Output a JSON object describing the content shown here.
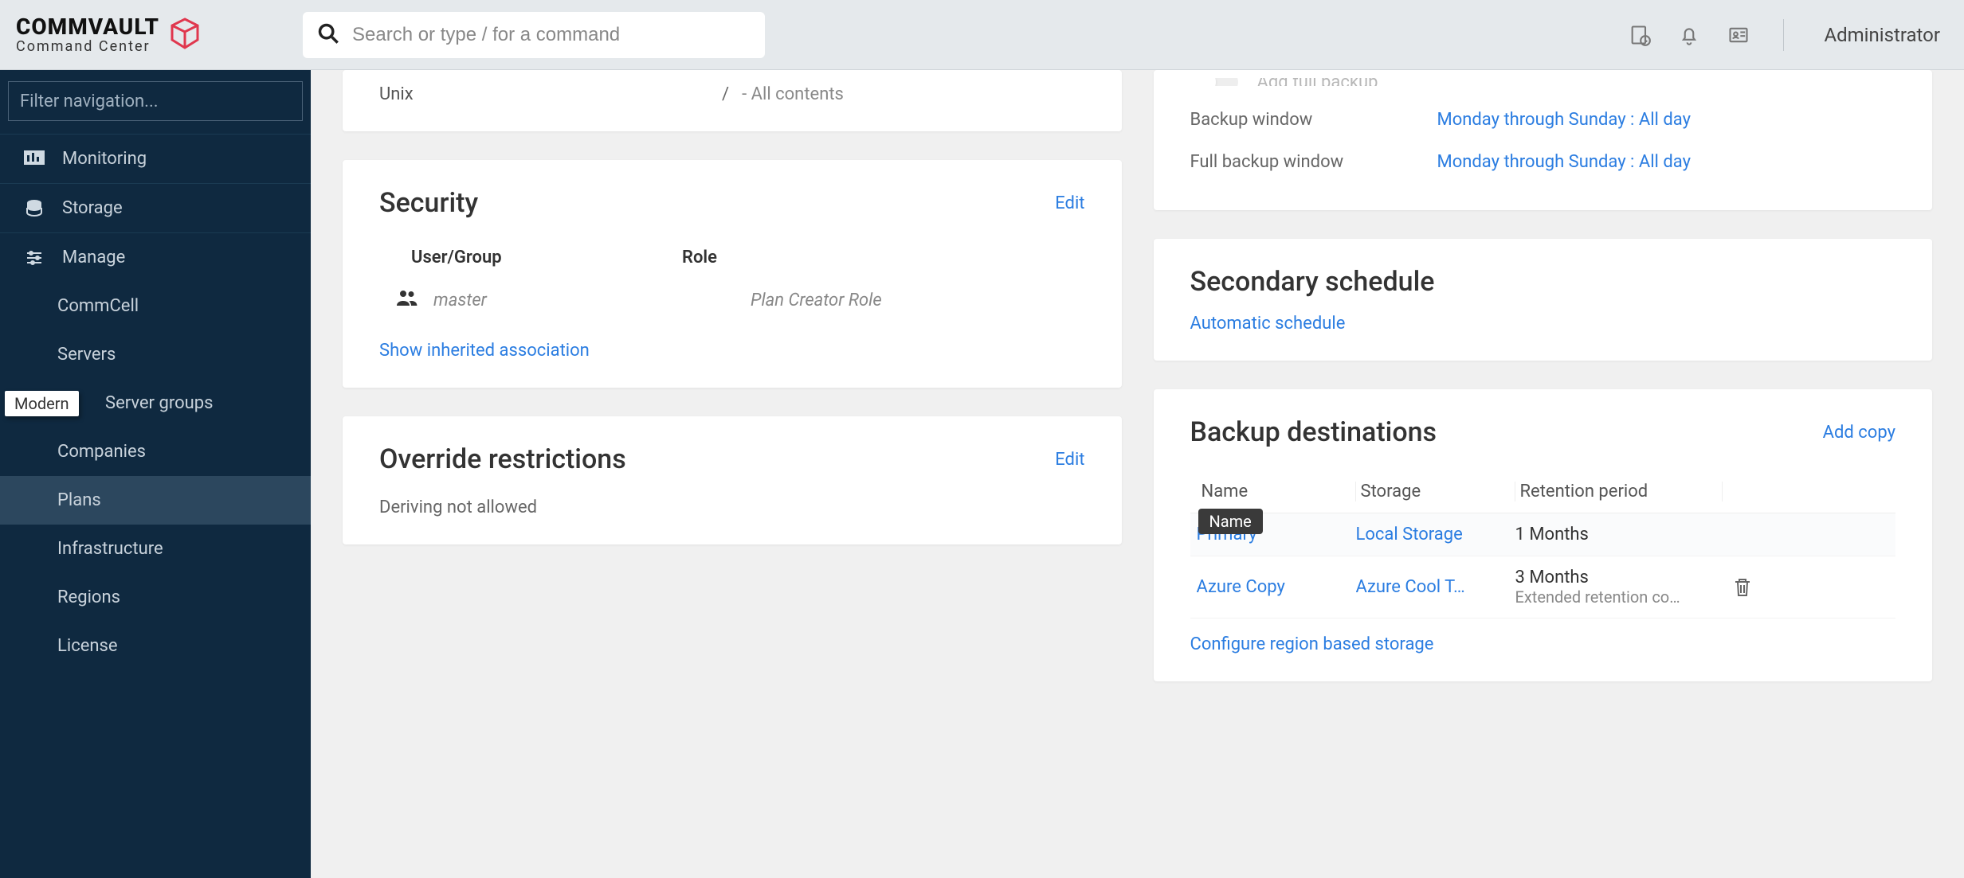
{
  "header": {
    "brand_line1": "COMMVAULT",
    "brand_line2": "Command Center",
    "search_placeholder": "Search or type / for a command",
    "user": "Administrator"
  },
  "sidebar": {
    "filter_placeholder": "Filter navigation...",
    "items": [
      {
        "label": "Monitoring"
      },
      {
        "label": "Storage"
      },
      {
        "label": "Manage"
      }
    ],
    "manage_children": [
      {
        "label": "CommCell"
      },
      {
        "label": "Servers"
      },
      {
        "label": "Server groups",
        "badge": "Modern"
      },
      {
        "label": "Companies"
      },
      {
        "label": "Plans",
        "active": true
      },
      {
        "label": "Infrastructure"
      },
      {
        "label": "Regions"
      },
      {
        "label": "License"
      }
    ]
  },
  "unix_card": {
    "label": "Unix",
    "path": "/",
    "desc": "-  All contents"
  },
  "security": {
    "title": "Security",
    "edit": "Edit",
    "col_user": "User/Group",
    "col_role": "Role",
    "rows": [
      {
        "user": "master",
        "role": "Plan Creator Role"
      }
    ],
    "show_inherited": "Show inherited association"
  },
  "override": {
    "title": "Override restrictions",
    "edit": "Edit",
    "text": "Deriving not allowed"
  },
  "schedule_top": {
    "toggle_label": "Add full backup",
    "rows": [
      {
        "k": "Backup window",
        "v": "Monday through Sunday : All day"
      },
      {
        "k": "Full backup window",
        "v": "Monday through Sunday : All day"
      }
    ]
  },
  "secondary": {
    "title": "Secondary schedule",
    "link": "Automatic schedule"
  },
  "destinations": {
    "title": "Backup destinations",
    "add": "Add copy",
    "col_name": "Name",
    "col_storage": "Storage",
    "col_ret": "Retention period",
    "tooltip": "Name",
    "rows": [
      {
        "name": "Primary",
        "storage": "Local Storage",
        "ret": "1 Months",
        "sub": "",
        "trash": false
      },
      {
        "name": "Azure Copy",
        "storage": "Azure Cool T…",
        "ret": "3 Months",
        "sub": "Extended retention co…",
        "trash": true
      }
    ],
    "configure": "Configure region based storage"
  }
}
